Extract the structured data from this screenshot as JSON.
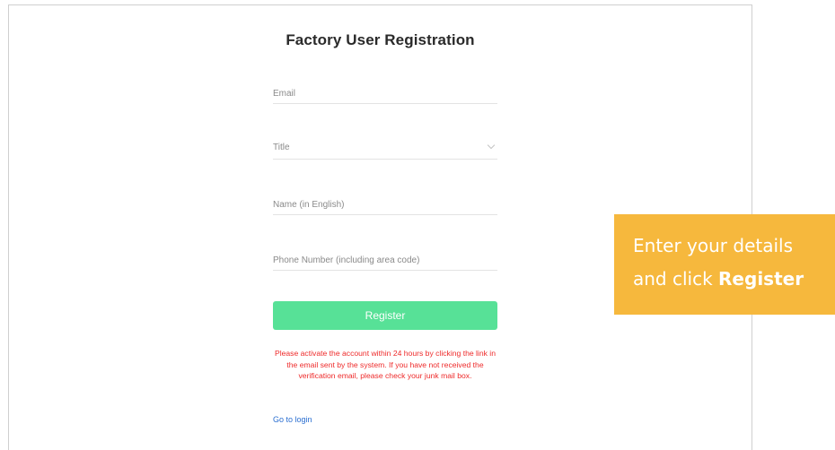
{
  "page": {
    "title": "Factory User Registration"
  },
  "form": {
    "email_placeholder": "Email",
    "title_placeholder": "Title",
    "name_placeholder": "Name (in English)",
    "phone_placeholder": "Phone Number (including area code)",
    "register_label": "Register",
    "notice": "Please activate the account within 24 hours by clicking the link in the email sent by the system. If you have not received the verification email, please check your junk mail box.",
    "login_link": "Go to login"
  },
  "callout": {
    "line1": "Enter your details",
    "line2_prefix": "and click ",
    "line2_bold": "Register"
  },
  "colors": {
    "register_button": "#57e197",
    "notice_text": "#ee2a2a",
    "link": "#2b6fd1",
    "callout_bg": "#f6b83d"
  },
  "icons": {
    "title_dropdown": "chevron-down-icon"
  }
}
